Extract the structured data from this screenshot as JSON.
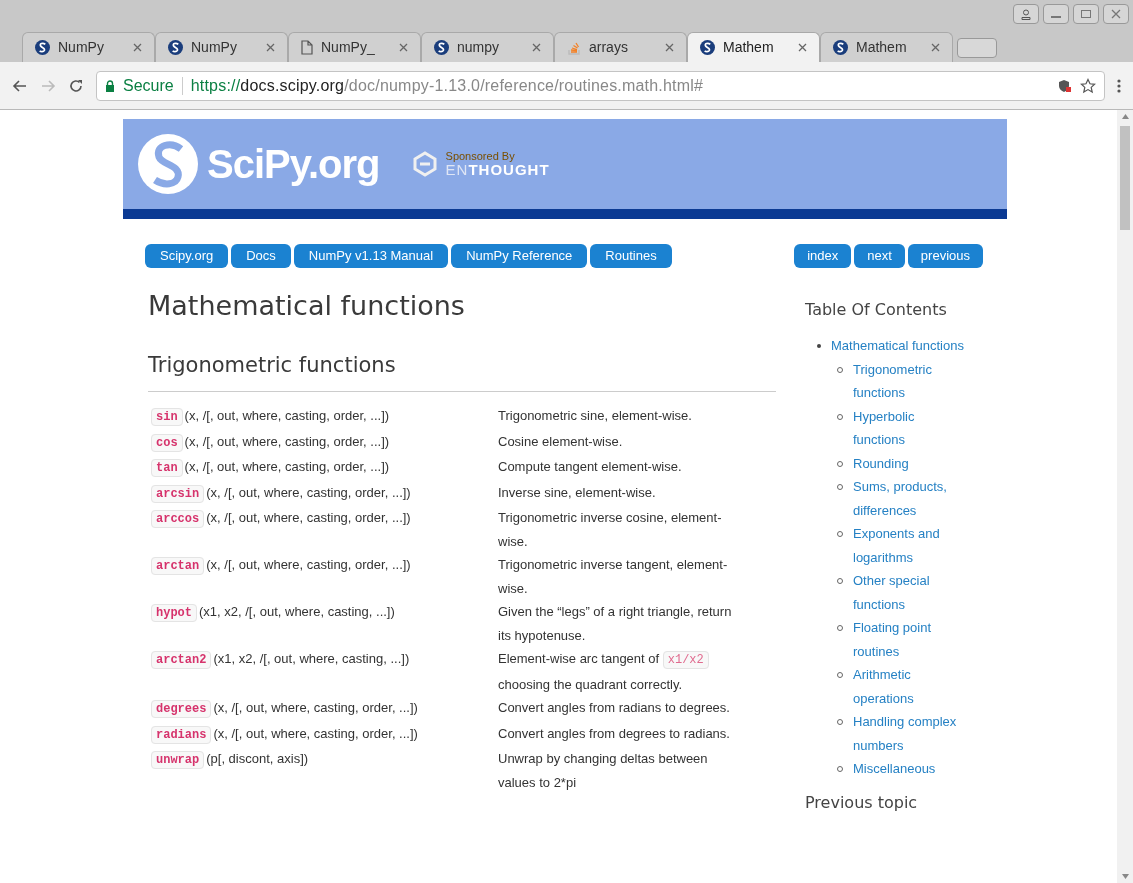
{
  "browser": {
    "tabs": [
      {
        "title": "NumPy",
        "kind": "scipy",
        "selected": false
      },
      {
        "title": "NumPy",
        "kind": "scipy",
        "selected": false
      },
      {
        "title": "NumPy_",
        "kind": "page",
        "selected": false
      },
      {
        "title": "numpy",
        "kind": "scipy",
        "selected": false
      },
      {
        "title": "arrays",
        "kind": "stack",
        "selected": false
      },
      {
        "title": "Mathem",
        "kind": "scipy",
        "selected": true
      },
      {
        "title": "Mathem",
        "kind": "scipy",
        "selected": false
      }
    ],
    "security": "Secure",
    "url_scheme": "https://",
    "url_host": "docs.scipy.org",
    "url_path": "/doc/numpy-1.13.0/reference/routines.math.html#"
  },
  "header": {
    "logo_text": "SciPy.org",
    "sponsor_label": "Sponsored By",
    "sponsor_name_light": "EN",
    "sponsor_name_bold": "THOUGHT"
  },
  "nav_left": [
    "Scipy.org",
    "Docs",
    "NumPy v1.13 Manual",
    "NumPy Reference",
    "Routines"
  ],
  "nav_right": [
    "index",
    "next",
    "previous"
  ],
  "title": "Mathematical functions",
  "section": "Trigonometric functions",
  "rows": [
    {
      "name": "sin",
      "signature": "(x, /[, out, where, casting, order, ...])",
      "description": [
        {
          "kind": "text",
          "text": "Trigonometric sine, element-wise."
        }
      ]
    },
    {
      "name": "cos",
      "signature": "(x, /[, out, where, casting, order, ...])",
      "description": [
        {
          "kind": "text",
          "text": "Cosine element-wise."
        }
      ]
    },
    {
      "name": "tan",
      "signature": "(x, /[, out, where, casting, order, ...])",
      "description": [
        {
          "kind": "text",
          "text": "Compute tangent element-wise."
        }
      ]
    },
    {
      "name": "arcsin",
      "signature": "(x, /[, out, where, casting, order, ...])",
      "description": [
        {
          "kind": "text",
          "text": "Inverse sine, element-wise."
        }
      ]
    },
    {
      "name": "arccos",
      "signature": "(x, /[, out, where, casting, order, ...])",
      "description": [
        {
          "kind": "text",
          "text": "Trigonometric inverse cosine, element-wise."
        }
      ]
    },
    {
      "name": "arctan",
      "signature": "(x, /[, out, where, casting, order, ...])",
      "description": [
        {
          "kind": "text",
          "text": "Trigonometric inverse tangent, element-wise."
        }
      ]
    },
    {
      "name": "hypot",
      "signature": "(x1, x2, /[, out, where, casting, ...])",
      "description": [
        {
          "kind": "text",
          "text": "Given the “legs” of a right triangle, return its hypotenuse."
        }
      ]
    },
    {
      "name": "arctan2",
      "signature": "(x1, x2, /[, out, where, casting, ...])",
      "description": [
        {
          "kind": "text",
          "text": "Element-wise arc tangent of "
        },
        {
          "kind": "code",
          "text": "x1/x2"
        },
        {
          "kind": "text",
          "text": " choosing the quadrant correctly."
        }
      ]
    },
    {
      "name": "degrees",
      "signature": "(x, /[, out, where, casting, order, ...])",
      "description": [
        {
          "kind": "text",
          "text": "Convert angles from radians to degrees."
        }
      ]
    },
    {
      "name": "radians",
      "signature": "(x, /[, out, where, casting, order, ...])",
      "description": [
        {
          "kind": "text",
          "text": "Convert angles from degrees to radians."
        }
      ]
    },
    {
      "name": "unwrap",
      "signature": "(p[, discont, axis])",
      "description": [
        {
          "kind": "text",
          "text": "Unwrap by changing deltas between values to 2*pi"
        }
      ]
    }
  ],
  "toc": {
    "heading": "Table Of Contents",
    "items": [
      {
        "label": "Mathematical functions",
        "children": [
          {
            "label": "Trigonometric functions"
          },
          {
            "label": "Hyperbolic functions"
          },
          {
            "label": "Rounding"
          },
          {
            "label": "Sums, products, differences"
          },
          {
            "label": "Exponents and logarithms"
          },
          {
            "label": "Other special functions"
          },
          {
            "label": "Floating point routines"
          },
          {
            "label": "Arithmetic operations"
          },
          {
            "label": "Handling complex numbers"
          },
          {
            "label": "Miscellaneous"
          }
        ]
      }
    ]
  },
  "previous_heading": "Previous topic"
}
